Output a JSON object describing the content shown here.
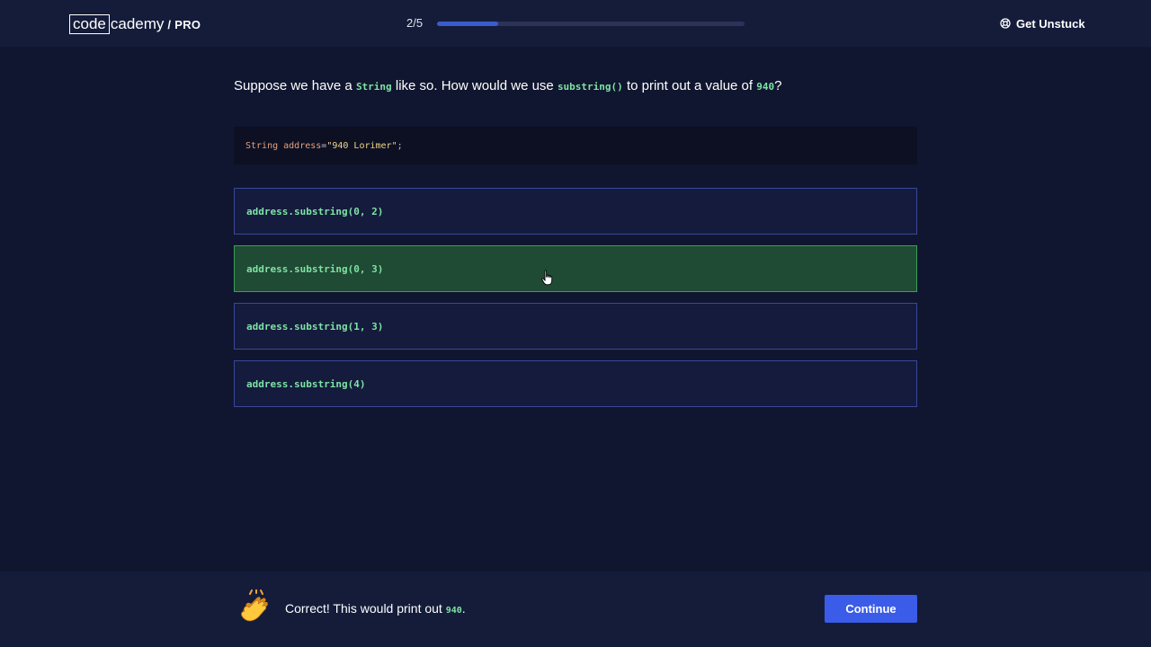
{
  "header": {
    "logo_boxed": "code",
    "logo_rest": "cademy",
    "logo_pro": "/ PRO",
    "progress_label": "2/5",
    "progress_fraction": 0.2,
    "get_unstuck_label": "Get Unstuck",
    "get_unstuck_icon": "lifebuoy-icon"
  },
  "question": {
    "part1": "Suppose we have a ",
    "code1": "String",
    "part2": " like so. How would we use ",
    "code2": "substring()",
    "part3": " to print out a value of ",
    "code3": "940",
    "part4": "?"
  },
  "code_block": {
    "type_token": "String address",
    "op_token": " = ",
    "str_token": "\"940 Lorimer\"",
    "punc_token": ";"
  },
  "options": [
    {
      "label": "address.substring(0, 2)",
      "state": "default"
    },
    {
      "label": "address.substring(0, 3)",
      "state": "correct"
    },
    {
      "label": "address.substring(1, 3)",
      "state": "default"
    },
    {
      "label": "address.substring(4)",
      "state": "default"
    }
  ],
  "feedback": {
    "emoji_icon": "clapping-hands-icon",
    "text": "Correct! This would print out ",
    "code": "940",
    "end": "."
  },
  "footer": {
    "continue_label": "Continue"
  },
  "colors": {
    "background": "#10162f",
    "header_bg": "#141c3a",
    "accent_blue": "#3a5ce8",
    "code_green": "#7ee3a4",
    "correct_bg": "#1f4a33",
    "correct_border": "#3aa05a",
    "option_border": "#3a4798"
  }
}
